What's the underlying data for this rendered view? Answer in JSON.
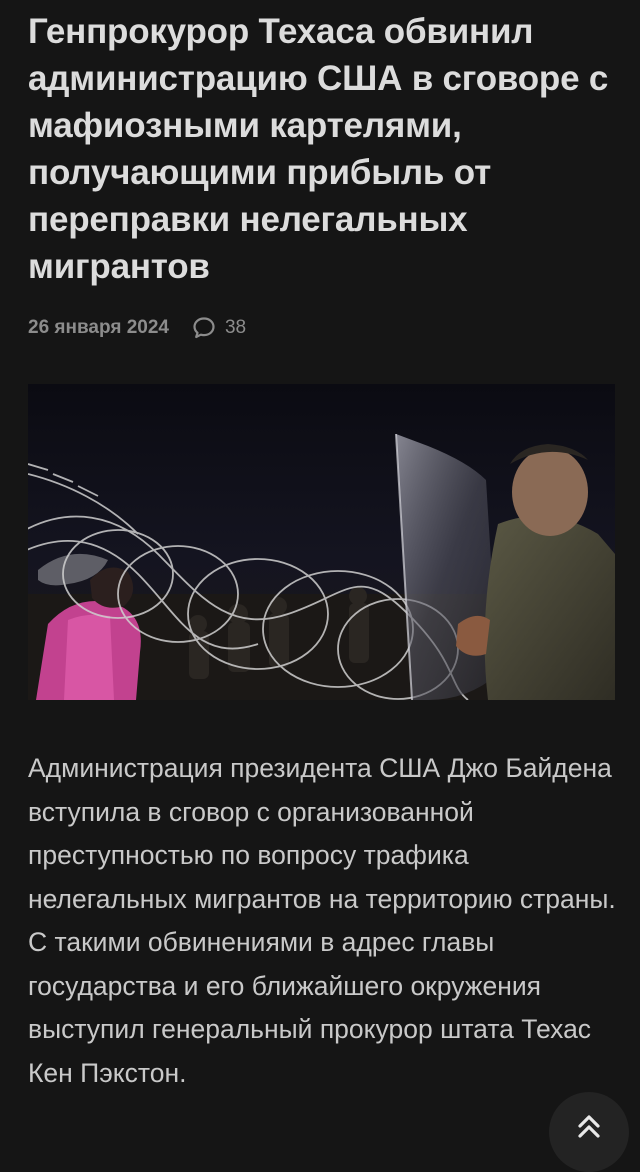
{
  "article": {
    "title": "Генпрокурор Техаса обвинил администрацию США в сговоре с мафиозными картелями, получающими прибыль от переправки нелегальных мигрантов",
    "date": "26 января 2024",
    "comments_count": "38",
    "comments_icon": "speech-bubble-icon",
    "image_alt": "photo-border-razor-wire-soldier-shield",
    "body": "Администрация президента США Джо Байдена вступила в сговор с организованной преступностью по вопросу трафика нелегальных мигрантов на территорию страны. С такими обвинениями в адрес главы государства и его ближайшего окружения выступил генеральный прокурор штата Техас Кен Пэкстон."
  },
  "controls": {
    "scroll_top_icon": "double-chevron-up-icon"
  },
  "colors": {
    "background": "#151515",
    "title": "#dcdcdc",
    "meta": "#8c8c8c",
    "body": "#c9c9c9",
    "fab": "#232323"
  }
}
